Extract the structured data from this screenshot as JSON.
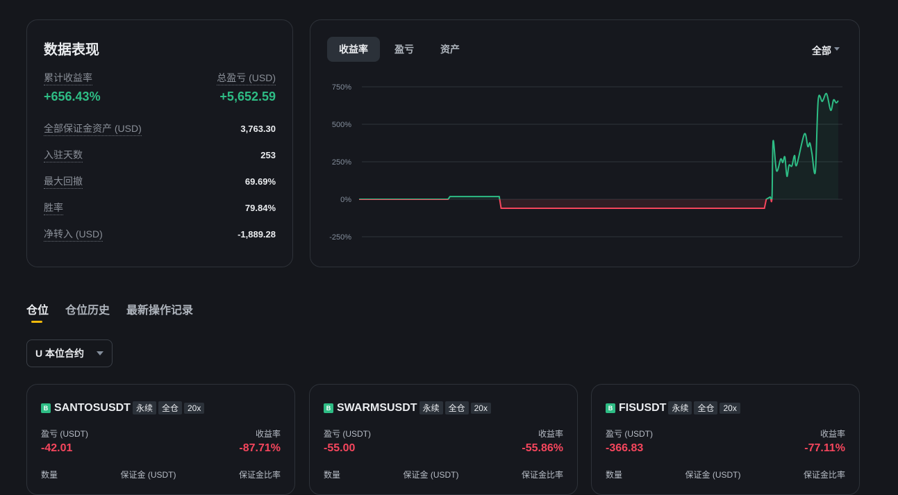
{
  "performance": {
    "title": "数据表现",
    "cum_return_label": "累计收益率",
    "total_pnl_label": "总盈亏 (USD)",
    "cum_return": "+656.43%",
    "total_pnl": "+5,652.59",
    "stats": [
      {
        "label": "全部保证金资产 (USD)",
        "value": "3,763.30"
      },
      {
        "label": "入驻天数",
        "value": "253"
      },
      {
        "label": "最大回撤",
        "value": "69.69%"
      },
      {
        "label": "胜率",
        "value": "79.84%"
      },
      {
        "label": "净转入 (USD)",
        "value": "-1,889.28"
      }
    ]
  },
  "chart": {
    "tabs": [
      "收益率",
      "盈亏",
      "资产"
    ],
    "active_tab": 0,
    "range": "全部"
  },
  "chart_data": {
    "type": "line",
    "title": "",
    "xlabel": "",
    "ylabel": "收益率",
    "ylim": [
      -300,
      800
    ],
    "yticks": [
      750,
      500,
      250,
      0,
      -250
    ],
    "ytick_labels": [
      "750%",
      "500%",
      "250%",
      "0%",
      "-250%"
    ],
    "grid": true,
    "colors": {
      "positive": "#2ebd85",
      "negative": "#f6465d"
    },
    "x": [
      0,
      47,
      48,
      74,
      75,
      214,
      215,
      217,
      218,
      218.6,
      220.4,
      222.6,
      223.7,
      224.8,
      225.9,
      227,
      228.5,
      229.9,
      231,
      235.1,
      236.9,
      238,
      239.1,
      240.9,
      242.4,
      244.6,
      246.8,
      249,
      250.5,
      251.9,
      253
    ],
    "y": [
      0,
      0,
      18,
      18,
      -60,
      -60,
      0,
      15,
      10,
      389,
      190,
      268,
      245,
      282,
      153,
      227,
      222,
      292,
      227,
      435,
      352,
      375,
      306,
      185,
      662,
      653,
      704,
      593,
      662,
      643,
      657
    ]
  },
  "positions": {
    "tabs": [
      "仓位",
      "仓位历史",
      "最新操作记录"
    ],
    "filter": "U 本位合约",
    "labels": {
      "pnl": "盈亏 (USDT)",
      "roe": "收益率",
      "qty": "数量",
      "margin": "保证金 (USDT)",
      "margin_ratio": "保证金比率"
    },
    "items": [
      {
        "badge": "B",
        "symbol": "SANTOSUSDT",
        "type": "永续",
        "mode": "全仓",
        "lev": "20x",
        "pnl": "-42.01",
        "roe": "-87.71%"
      },
      {
        "badge": "B",
        "symbol": "SWARMSUSDT",
        "type": "永续",
        "mode": "全仓",
        "lev": "20x",
        "pnl": "-55.00",
        "roe": "-55.86%"
      },
      {
        "badge": "B",
        "symbol": "FISUSDT",
        "type": "永续",
        "mode": "全仓",
        "lev": "20x",
        "pnl": "-366.83",
        "roe": "-77.11%"
      }
    ]
  }
}
